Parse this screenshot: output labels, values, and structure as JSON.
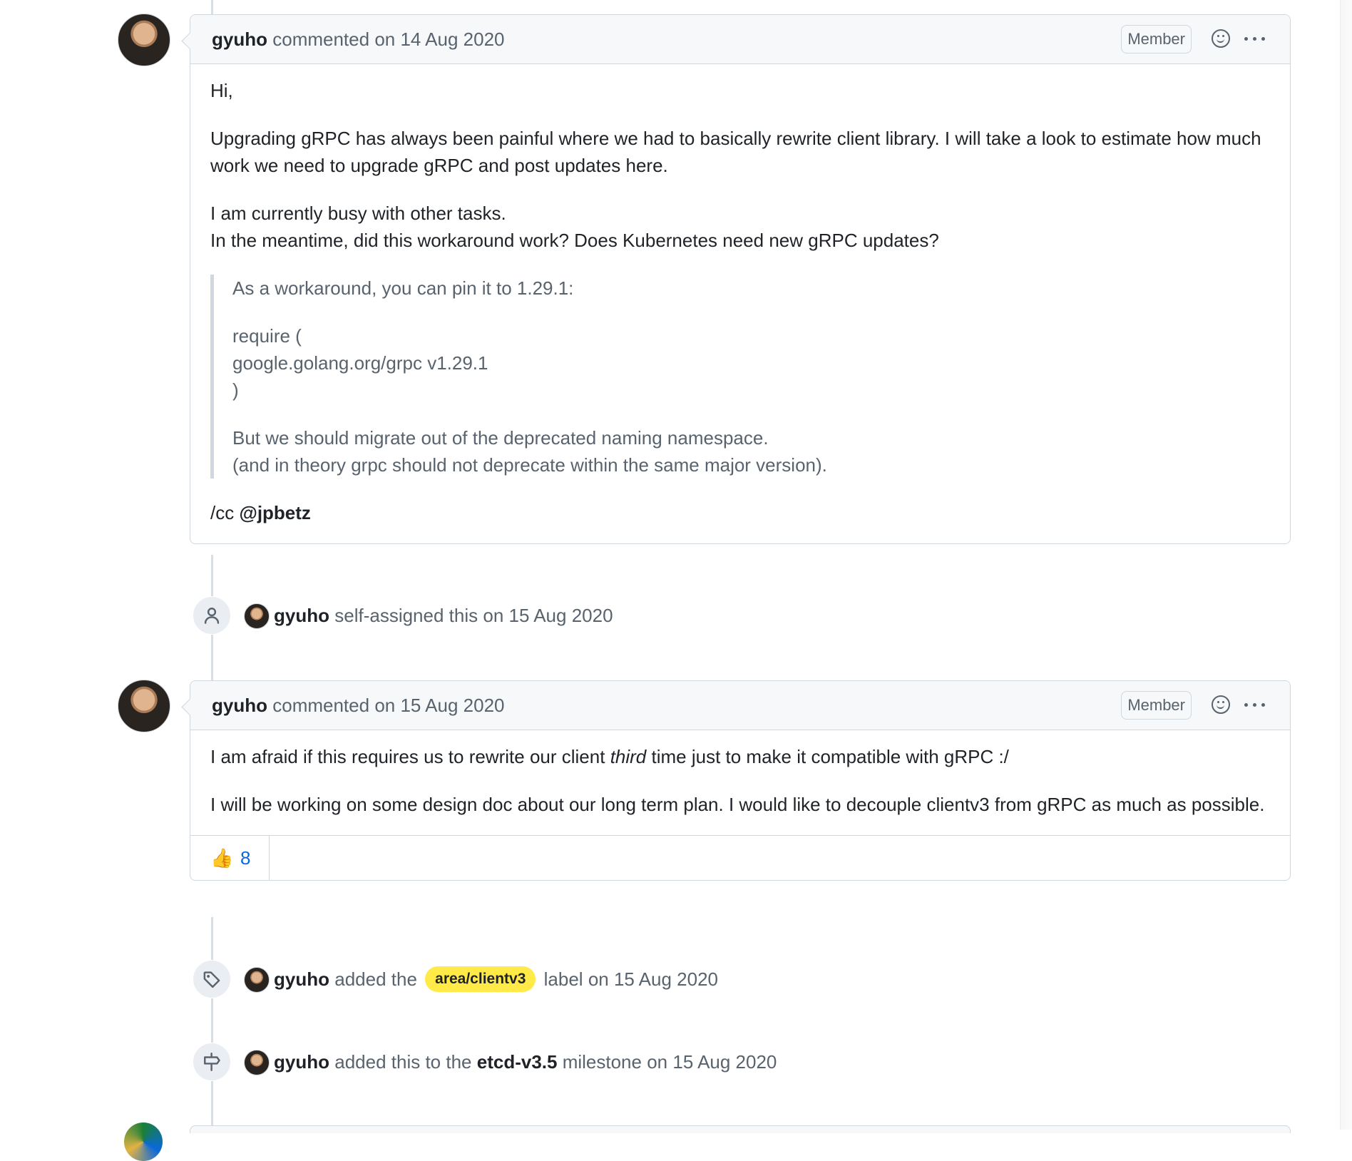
{
  "comments": [
    {
      "author": "gyuho",
      "action": "commented",
      "date": "on 14 Aug 2020",
      "badge": "Member",
      "body": {
        "p1": "Hi,",
        "p2": "Upgrading gRPC has always been painful where we had to basically rewrite client library. I will take a look to estimate how much work we need to upgrade gRPC and post updates here.",
        "p3_line1": "I am currently busy with other tasks.",
        "p3_line2": "In the meantime, did this workaround work? Does Kubernetes need new gRPC updates?",
        "quote": {
          "q1": "As a workaround, you can pin it to 1.29.1:",
          "q2_line1": "require (",
          "q2_line2": "google.golang.org/grpc v1.29.1",
          "q2_line3": ")",
          "q3_line1": "But we should migrate out of the deprecated naming namespace.",
          "q3_line2": "(and in theory grpc should not deprecate within the same major version)."
        },
        "cc_prefix": "/cc",
        "cc_mention": "@jpbetz"
      }
    },
    {
      "author": "gyuho",
      "action": "commented",
      "date": "on 15 Aug 2020",
      "badge": "Member",
      "body": {
        "p1_before": "I am afraid if this requires us to rewrite our client",
        "p1_em": "third",
        "p1_after": "time just to make it compatible with gRPC :/",
        "p2": "I will be working on some design doc about our long term plan. I would like to decouple clientv3 from gRPC as much as possible."
      },
      "reactions": [
        {
          "emoji": "👍",
          "icon": "thumbs-up-icon",
          "count": "8"
        }
      ]
    }
  ],
  "events": [
    {
      "icon": "person-icon",
      "actor": "gyuho",
      "text": "self-assigned this",
      "date": "on 15 Aug 2020"
    },
    {
      "icon": "tag-icon",
      "actor": "gyuho",
      "text_before": "added the",
      "label": "area/clientv3",
      "label_color": "#ffea47",
      "text_after": "label",
      "date": "on 15 Aug 2020"
    },
    {
      "icon": "milestone-icon",
      "actor": "gyuho",
      "text_before": "added this to the",
      "milestone": "etcd-v3.5",
      "text_after": "milestone",
      "date": "on 15 Aug 2020"
    }
  ],
  "colors": {
    "link_blue": "#0969da",
    "muted_text": "#59636e",
    "border": "#d0d7de",
    "header_bg": "#f6f8fa",
    "label_yellow": "#ffea47"
  }
}
